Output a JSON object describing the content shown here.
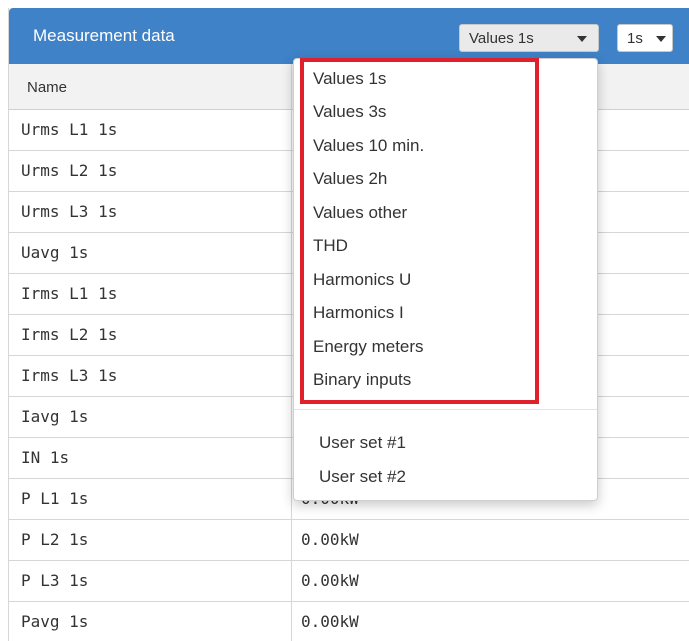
{
  "header": {
    "title": "Measurement data",
    "values_select": "Values 1s",
    "interval_select": "1s"
  },
  "table": {
    "columns": [
      "Name"
    ],
    "rows": [
      {
        "name": "Urms L1 1s",
        "value": ""
      },
      {
        "name": "Urms L2 1s",
        "value": ""
      },
      {
        "name": "Urms L3 1s",
        "value": ""
      },
      {
        "name": "Uavg 1s",
        "value": ""
      },
      {
        "name": "Irms L1 1s",
        "value": ""
      },
      {
        "name": "Irms L2 1s",
        "value": ""
      },
      {
        "name": "Irms L3 1s",
        "value": ""
      },
      {
        "name": "Iavg 1s",
        "value": ""
      },
      {
        "name": "IN 1s",
        "value": ""
      },
      {
        "name": "P L1 1s",
        "value": "0.00kW"
      },
      {
        "name": "P L2 1s",
        "value": "0.00kW"
      },
      {
        "name": "P L3 1s",
        "value": "0.00kW"
      },
      {
        "name": "Pavg 1s",
        "value": "0.00kW"
      }
    ]
  },
  "dropdown": {
    "items": [
      "Values 1s",
      "Values 3s",
      "Values 10 min.",
      "Values 2h",
      "Values other",
      "THD",
      "Harmonics U",
      "Harmonics I",
      "Energy meters",
      "Binary inputs"
    ],
    "user_sets": [
      "User set #1",
      "User set #2"
    ]
  },
  "colors": {
    "header_bg": "#3f82c7",
    "highlight": "#e0202a"
  }
}
